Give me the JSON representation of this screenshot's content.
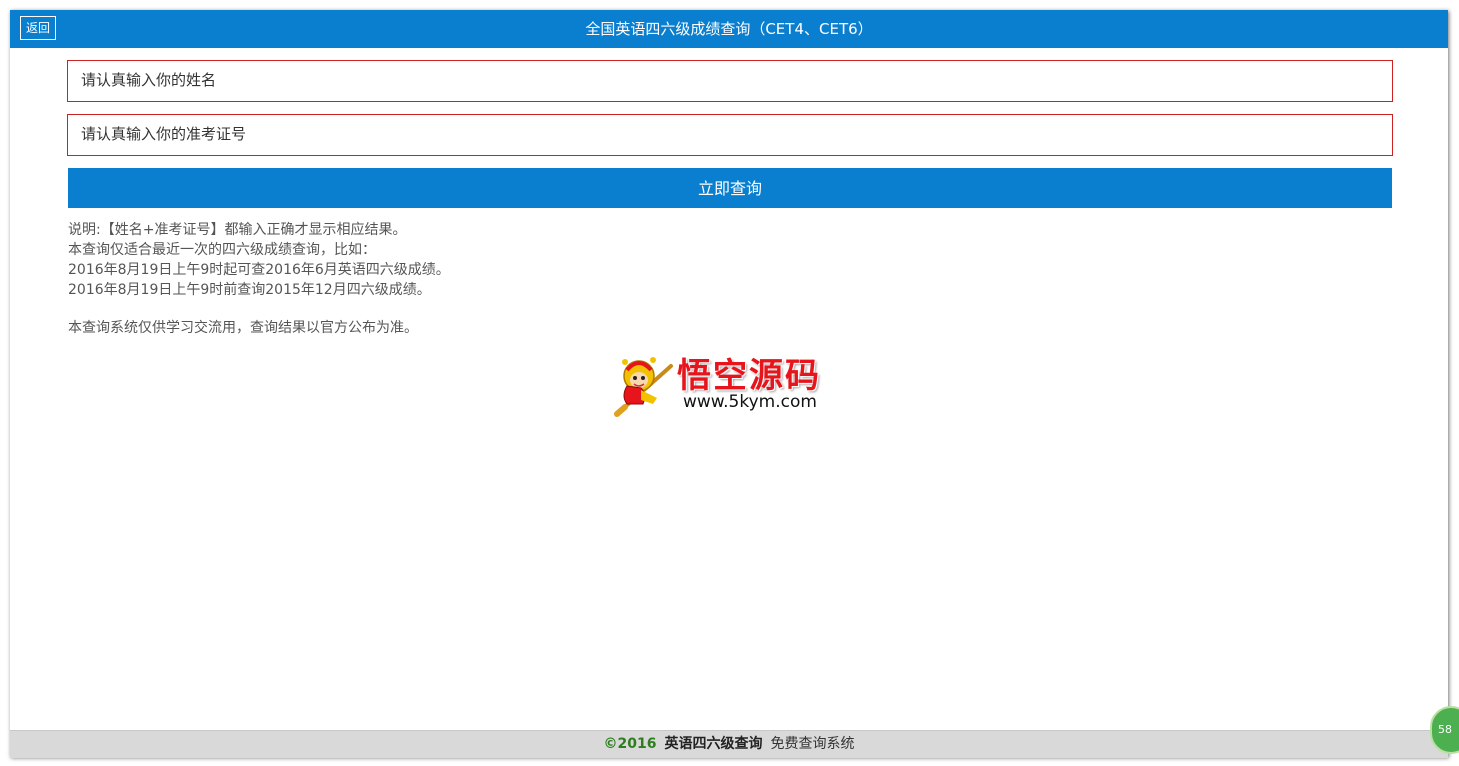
{
  "header": {
    "back_label": "返回",
    "title": "全国英语四六级成绩查询（CET4、CET6）"
  },
  "form": {
    "name_placeholder": "请认真输入你的姓名",
    "ticket_placeholder": "请认真输入你的准考证号",
    "submit_label": "立即查询"
  },
  "notes": {
    "lines": [
      "说明:【姓名+准考证号】都输入正确才显示相应结果。",
      "本查询仅适合最近一次的四六级成绩查询，比如：",
      "2016年8月19日上午9时起可查2016年6月英语四六级成绩。",
      "2016年8月19日上午9时前查询2015年12月四六级成绩。"
    ],
    "disclaimer": "本查询系统仅供学习交流用，查询结果以官方公布为准。"
  },
  "logo": {
    "title": "悟空源码",
    "url": "www.5kym.com"
  },
  "footer": {
    "copyright": "©2016",
    "brand": "英语四六级查询",
    "subtitle": "免费查询系统"
  },
  "floating_badge": {
    "label": "58"
  },
  "colors": {
    "primary": "#0a7fcf",
    "field_border": "#cc2222",
    "footer_bg": "#d9d9d9",
    "copyright_green": "#2e7d1f",
    "logo_red": "#e8141c"
  }
}
